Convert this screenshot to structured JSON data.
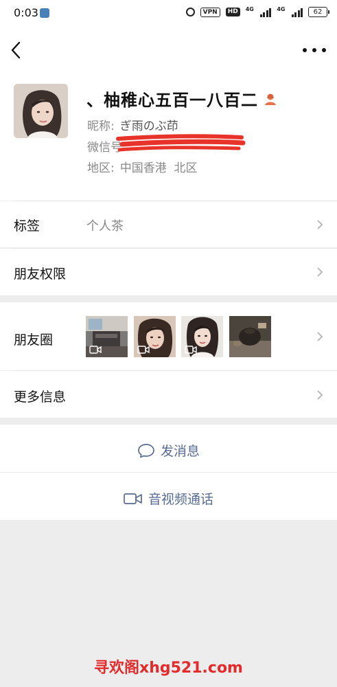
{
  "status_bar": {
    "time": "0:03",
    "vpn": "VPN",
    "hd": "HD",
    "network_1": "4G",
    "network_2": "4G",
    "battery": "62"
  },
  "header": {
    "back_icon": "chevron-left-icon",
    "more_icon": "ellipsis-icon"
  },
  "profile": {
    "name": "、柚稚心五百一八百二",
    "gender_icon": "female-user-icon",
    "gender_color": "#e8744f",
    "nickname_label": "昵称:",
    "nickname": "ぎ雨のぶ茚",
    "wechat_id_label": "微信号:",
    "region_label": "地区:",
    "region": "中国香港  北区"
  },
  "rows": {
    "tags_label": "标签",
    "tags_value": "个人茶",
    "permission_label": "朋友权限",
    "moments_label": "朋友圈",
    "more_info_label": "更多信息"
  },
  "actions": {
    "send_message": "发消息",
    "send_message_icon": "chat-bubble-icon",
    "av_call": "音视频通话",
    "av_call_icon": "video-camera-icon",
    "link_color": "#576b95"
  },
  "watermark": "寻欢阁xhg521.com"
}
